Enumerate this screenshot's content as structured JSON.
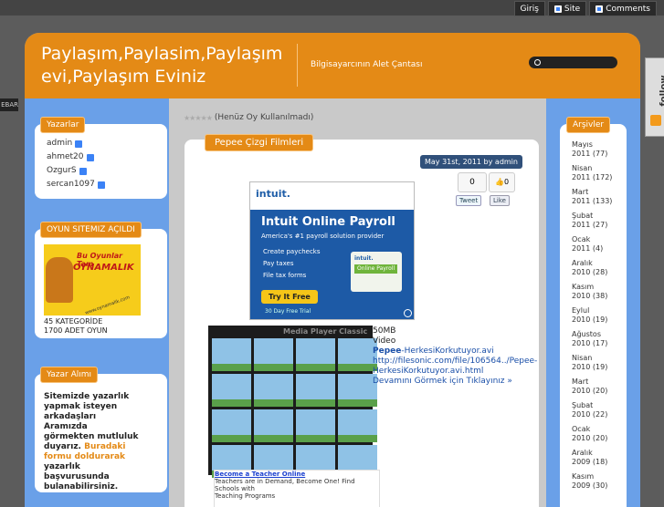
{
  "topnav": {
    "login": "Giriş",
    "site": "Site",
    "comments": "Comments"
  },
  "header": {
    "title": "Paylaşım,Paylasim,Paylaşım evi,Paylaşım Eviniz",
    "tagline": "Bilgisayarcının Alet Çantası"
  },
  "sidebar_tab": "EBAR",
  "follow": "follow",
  "left_sidebar": {
    "authors": {
      "title": "Yazarlar",
      "items": [
        "admin",
        "ahmet20",
        "OzgurS",
        "sercan1097"
      ]
    },
    "game": {
      "title": "OYUN SITEMIZ AÇILDI",
      "banner_line1": "Bu Oyunlar Tam",
      "banner_line2": "OYNAMALIK",
      "banner_url": "www.oynamalik.com",
      "caption_line1": "45 KATEGORİDE",
      "caption_line2": "1700 ADET OYUN"
    },
    "recruit": {
      "title": "Yazar Alımı",
      "text": "Sitemizde yazarlık yapmak isteyen arkadaşları Aramızda görmekten mutluluk duyarız.",
      "link_text": "Buradaki formu doldurarak",
      "text2": "yazarlık başvurusunda bulanabilirsiniz."
    }
  },
  "post": {
    "rating_text": "(Henüz Oy Kullanılmadı)",
    "title": "Pepee Çizgi Filmleri",
    "date": "May 31st, 2011 by admin",
    "share_count": "0",
    "like_count": "0",
    "tweet": "Tweet",
    "fb_like": "Like",
    "ad": {
      "brand": "intuit.",
      "headline": "Intuit Online Payroll",
      "subline": "America's #1 payroll solution provider",
      "bullets": [
        "Create paychecks",
        "Pay taxes",
        "File tax forms"
      ],
      "cta": "Try It Free",
      "footnote": "30 Day Free Trial",
      "box_brand": "intuit.",
      "box_label": "Online Payroll"
    },
    "screenshot_title": "Media Player Classic",
    "size": "50MB",
    "kind": "Video",
    "file_name_bold": "Pepee",
    "file_name_rest": "-HerkesiKorkutuyor.avi",
    "url_line1": "http://filesonic.com/file/106564../Pepee-",
    "url_line2": "HerkesiKorkutuyor.avi.html",
    "read_more": "Devamını Görmek için Tıklayınız »",
    "bottom_ad": {
      "title": "Become a Teacher Online",
      "line1": "Teachers are in Demand, Become One! Find Schools with",
      "line2": "Teaching Programs"
    }
  },
  "archives": {
    "title": "Arşivler",
    "items": [
      {
        "month": "Mayıs",
        "year": "2011",
        "count": "(77)"
      },
      {
        "month": "Nisan",
        "year": "2011",
        "count": "(172)"
      },
      {
        "month": "Mart",
        "year": "2011",
        "count": "(133)"
      },
      {
        "month": "Şubat",
        "year": "2011",
        "count": "(27)"
      },
      {
        "month": "Ocak",
        "year": "2011",
        "count": "(4)"
      },
      {
        "month": "Aralık",
        "year": "2010",
        "count": "(28)"
      },
      {
        "month": "Kasım",
        "year": "2010",
        "count": "(38)"
      },
      {
        "month": "Eylul",
        "year": "2010",
        "count": "(19)"
      },
      {
        "month": "Ağustos",
        "year": "2010",
        "count": "(17)"
      },
      {
        "month": "Nisan",
        "year": "2010",
        "count": "(19)"
      },
      {
        "month": "Mart",
        "year": "2010",
        "count": "(20)"
      },
      {
        "month": "Şubat",
        "year": "2010",
        "count": "(22)"
      },
      {
        "month": "Ocak",
        "year": "2010",
        "count": "(20)"
      },
      {
        "month": "Aralık",
        "year": "2009",
        "count": "(18)"
      },
      {
        "month": "Kasım",
        "year": "2009",
        "count": "(30)"
      }
    ]
  }
}
